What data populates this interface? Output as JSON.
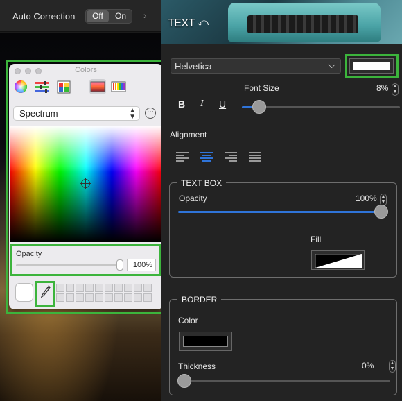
{
  "top_bar": {
    "label": "Auto Correction",
    "toggle_off": "Off",
    "toggle_on": "On",
    "selected": "Off",
    "chevron": "›"
  },
  "colors_panel": {
    "title": "Colors",
    "modes": [
      "color-wheel-icon",
      "sliders-icon",
      "palettes-icon",
      "image-palettes-icon",
      "pencils-icon"
    ],
    "selected_mode": "image-palettes-icon",
    "palette_select": "Spectrum",
    "more_button": "⋯",
    "opacity_label": "Opacity",
    "opacity_value": "100%",
    "opacity_level": 1.0,
    "swatch_color": "#ffffff",
    "eyedropper_glyph": "✎"
  },
  "header": {
    "title": "TEXT",
    "undo_glyph": "⤺"
  },
  "font": {
    "family": "Helvetica",
    "dropdown_glyph": "⌵",
    "color": "#ffffff"
  },
  "font_size": {
    "label": "Font Size",
    "value": "8%",
    "level": 0.08
  },
  "format": {
    "bold": "B",
    "italic": "I",
    "underline": "U"
  },
  "alignment": {
    "label": "Alignment",
    "options": [
      "align-left-icon",
      "align-center-icon",
      "align-right-icon",
      "align-justify-icon"
    ],
    "selected": "align-center-icon"
  },
  "text_box": {
    "title": "TEXT BOX",
    "opacity_label": "Opacity",
    "opacity_value": "100%",
    "opacity_level": 1.0,
    "fill_label": "Fill",
    "fill_color": "none"
  },
  "border": {
    "title": "BORDER",
    "color_label": "Color",
    "color": "#000000",
    "thickness_label": "Thickness",
    "thickness_value": "0%",
    "thickness_level": 0.0
  },
  "stepper": {
    "up": "▲",
    "down": "▼"
  },
  "accent_color": "#2f74d9",
  "highlight_color": "#3cb43c"
}
